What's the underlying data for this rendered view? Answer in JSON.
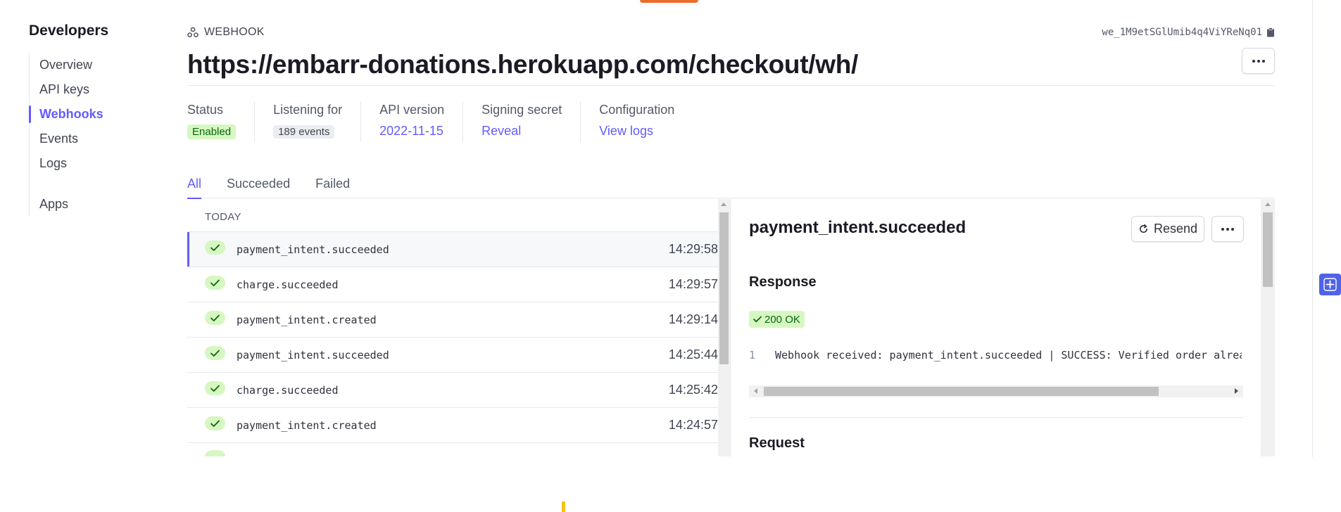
{
  "sidebar": {
    "title": "Developers",
    "items": [
      {
        "label": "Overview"
      },
      {
        "label": "API keys"
      },
      {
        "label": "Webhooks"
      },
      {
        "label": "Events"
      },
      {
        "label": "Logs"
      },
      {
        "label": "Apps"
      }
    ],
    "active_item": "Webhooks"
  },
  "header": {
    "type_label": "WEBHOOK",
    "type_icon": "webhook-icon",
    "endpoint_id": "we_1M9etSGlUmib4q4ViYReNq01",
    "url": "https://embarr-donations.herokuapp.com/checkout/wh/"
  },
  "meta": {
    "status": {
      "label": "Status",
      "value": "Enabled"
    },
    "listening": {
      "label": "Listening for",
      "value": "189 events"
    },
    "api_version": {
      "label": "API version",
      "value": "2022-11-15"
    },
    "signing_secret": {
      "label": "Signing secret",
      "value": "Reveal"
    },
    "configuration": {
      "label": "Configuration",
      "value": "View logs"
    }
  },
  "tabs": [
    {
      "label": "All"
    },
    {
      "label": "Succeeded"
    },
    {
      "label": "Failed"
    }
  ],
  "events": {
    "section_label": "TODAY",
    "rows": [
      {
        "name": "payment_intent.succeeded",
        "time": "14:29:58"
      },
      {
        "name": "charge.succeeded",
        "time": "14:29:57"
      },
      {
        "name": "payment_intent.created",
        "time": "14:29:14"
      },
      {
        "name": "payment_intent.succeeded",
        "time": "14:25:44"
      },
      {
        "name": "charge.succeeded",
        "time": "14:25:42"
      },
      {
        "name": "payment_intent.created",
        "time": "14:24:57"
      }
    ]
  },
  "detail": {
    "title": "payment_intent.succeeded",
    "resend_label": "Resend",
    "response_heading": "Response",
    "response_status": "200 OK",
    "response_line_number": "1",
    "response_body": "Webhook received: payment_intent.succeeded | SUCCESS: Verified order already in database",
    "request_heading": "Request"
  },
  "colors": {
    "accent": "#635bff",
    "success_bg": "#d7f7c2",
    "success_text": "#05690d"
  }
}
